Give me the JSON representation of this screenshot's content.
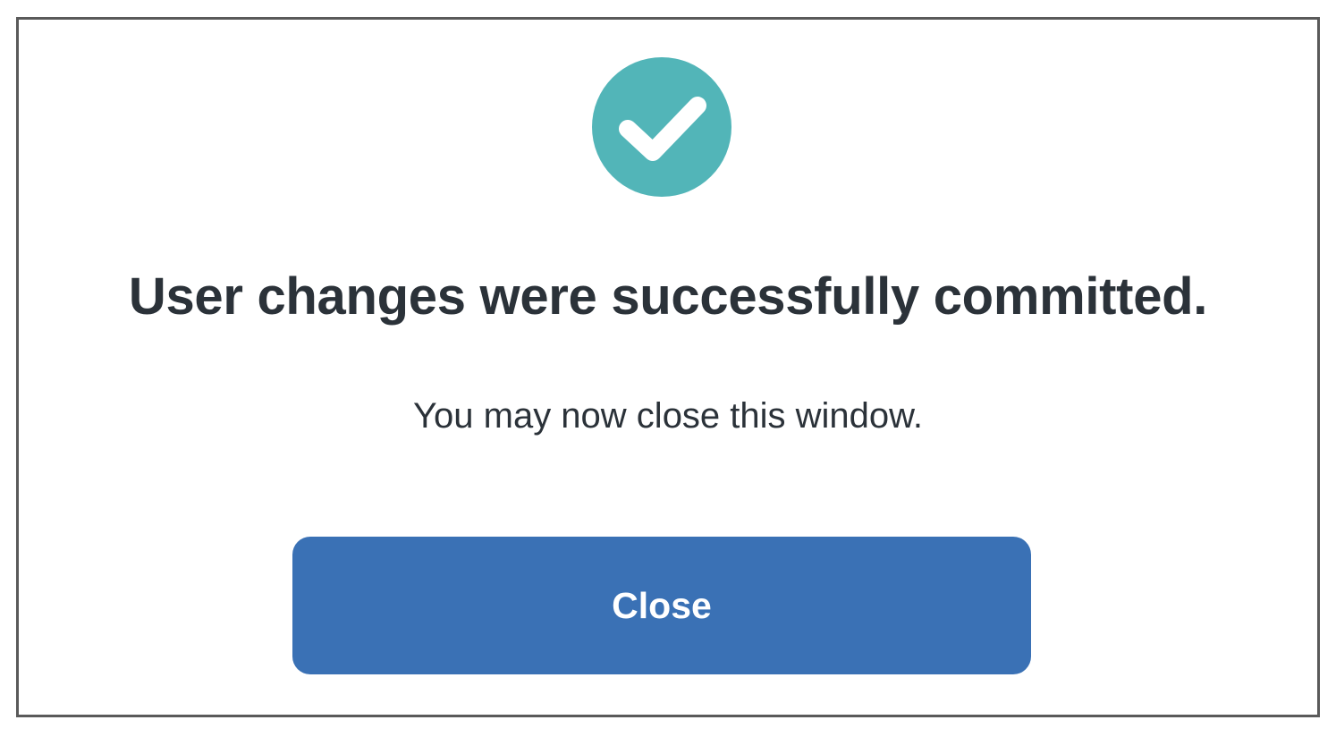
{
  "dialog": {
    "icon": "check-circle-icon",
    "title": "User changes were successfully committed.",
    "message": "You may now close this window.",
    "close_label": "Close"
  },
  "colors": {
    "accent": "#52B5B8",
    "text": "#2B3239",
    "button": "#3A71B5",
    "border": "#5A5A5A"
  }
}
